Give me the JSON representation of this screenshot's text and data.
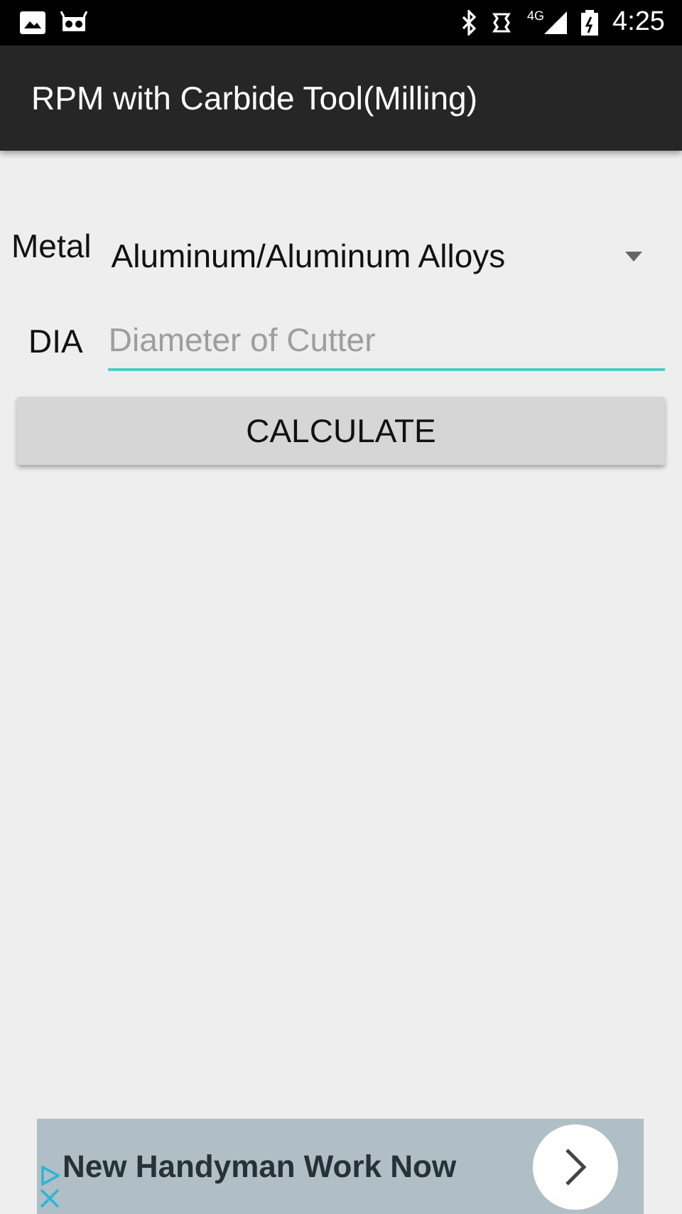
{
  "status_bar": {
    "time": "4:25",
    "network": "4G"
  },
  "toolbar": {
    "title": "RPM with Carbide Tool(Milling)"
  },
  "metal": {
    "label": "Metal",
    "value": "Aluminum/Aluminum Alloys"
  },
  "diameter": {
    "label": "DIA",
    "placeholder": "Diameter of Cutter"
  },
  "calculate_button": "CALCULATE",
  "ad": {
    "headline": "New Handyman Work Now"
  }
}
